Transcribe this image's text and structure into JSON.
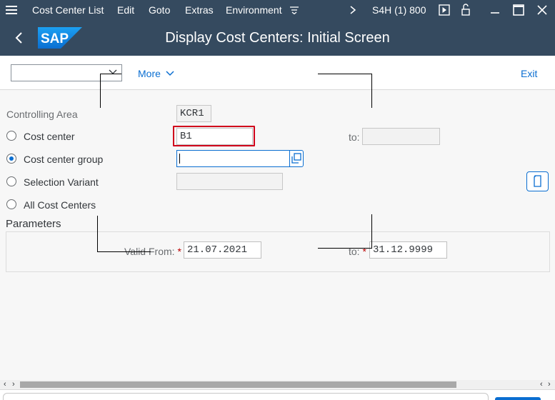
{
  "menu": {
    "items": [
      {
        "label": "Cost Center List"
      },
      {
        "label": "Edit"
      },
      {
        "label": "Goto"
      },
      {
        "label": "Extras"
      },
      {
        "label": "Environment"
      }
    ],
    "system": "S4H (1) 800"
  },
  "header": {
    "title": "Display Cost Centers: Initial Screen",
    "logo_text": "SAP",
    "brand_color": "#0a6ed1",
    "bar_color": "#354a5f"
  },
  "toolbar": {
    "combo_value": "",
    "more_label": "More",
    "exit_label": "Exit"
  },
  "form": {
    "controlling_area": {
      "label": "Controlling Area",
      "value": "KCR1"
    },
    "cost_center": {
      "label": "Cost center",
      "value": "B1",
      "to_label": "to:",
      "to_value": "",
      "selected": false
    },
    "cost_center_group": {
      "label": "Cost center group",
      "value": "",
      "selected": true
    },
    "selection_variant": {
      "label": "Selection Variant",
      "value": "",
      "selected": false
    },
    "all_cost_centers": {
      "label": "All Cost Centers",
      "selected": false
    }
  },
  "parameters": {
    "title": "Parameters",
    "valid_from": {
      "label": "Valid From:",
      "required_mark": "*",
      "value": "21.07.2021"
    },
    "valid_to": {
      "label": "to:",
      "required_mark": "*",
      "value": "31.12.9999"
    }
  }
}
